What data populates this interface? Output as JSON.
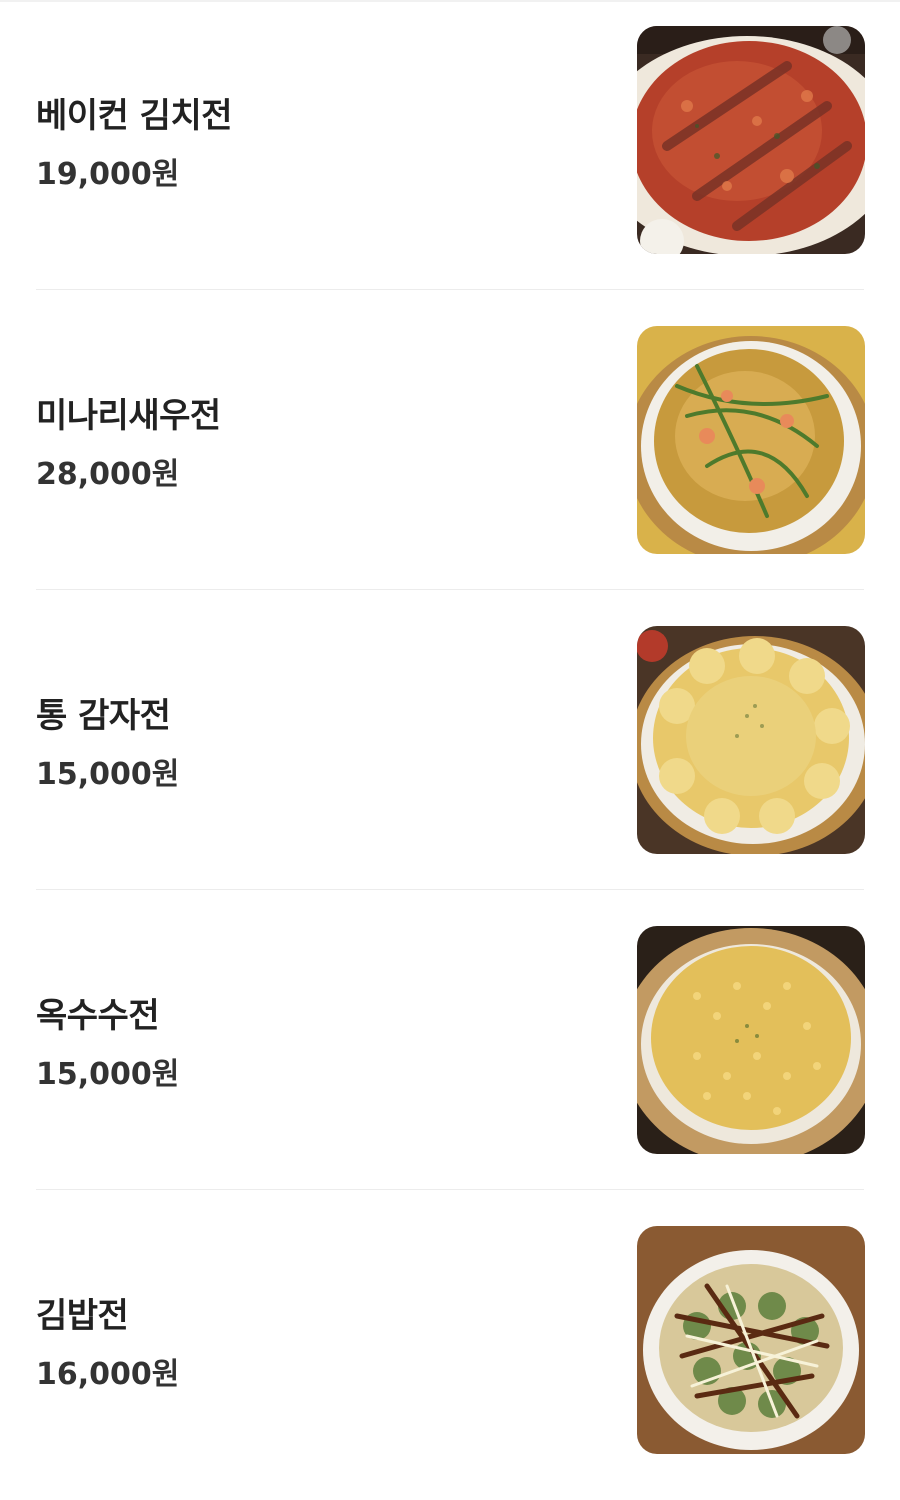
{
  "menu": {
    "items": [
      {
        "name": "베이컨 김치전",
        "price": "19,000원",
        "image": "bacon-kimchi-pancake-photo",
        "accent": "#b5402a"
      },
      {
        "name": "미나리새우전",
        "price": "28,000원",
        "image": "minari-shrimp-pancake-photo",
        "accent": "#c79a3d"
      },
      {
        "name": "통 감자전",
        "price": "15,000원",
        "image": "potato-pancake-photo",
        "accent": "#e8c86a"
      },
      {
        "name": "옥수수전",
        "price": "15,000원",
        "image": "corn-pancake-photo",
        "accent": "#e3bf5a"
      },
      {
        "name": "김밥전",
        "price": "16,000원",
        "image": "gimbap-pancake-photo",
        "accent": "#6a3a1c"
      }
    ]
  }
}
